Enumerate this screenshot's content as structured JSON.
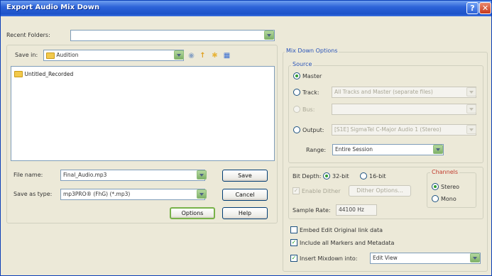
{
  "window": {
    "title": "Export Audio Mix Down"
  },
  "recent": {
    "label": "Recent Folders:",
    "value": ""
  },
  "savein": {
    "label": "Save in:",
    "folder": "Audition"
  },
  "files": [
    "Untitled_Recorded"
  ],
  "filename": {
    "label": "File name:",
    "value": "Final_Audio.mp3"
  },
  "savetype": {
    "label": "Save as type:",
    "value": "mp3PRO® (FhG) (*.mp3)"
  },
  "buttons": {
    "save": "Save",
    "cancel": "Cancel",
    "options": "Options",
    "help": "Help"
  },
  "mixdown": {
    "legend": "Mix Down Options",
    "source_legend": "Source",
    "master": "Master",
    "track": "Track:",
    "track_value": "All Tracks and Master (separate files)",
    "bus": "Bus:",
    "output": "Output:",
    "output_value": "[S1E] SigmaTel C-Major Audio 1 (Stereo)",
    "range_label": "Range:",
    "range_value": "Entire Session",
    "bitdepth_label": "Bit Depth:",
    "bit32": "32-bit",
    "bit16": "16-bit",
    "channels_legend": "Channels",
    "stereo": "Stereo",
    "mono": "Mono",
    "dither": "Enable Dither",
    "dither_options": "Dither Options...",
    "sample_rate_label": "Sample Rate:",
    "sample_rate_value": "44100 Hz",
    "embed": "Embed Edit Original link data",
    "include_markers": "Include all Markers and Metadata",
    "insert_label": "Insert Mixdown into:",
    "insert_value": "Edit View"
  }
}
